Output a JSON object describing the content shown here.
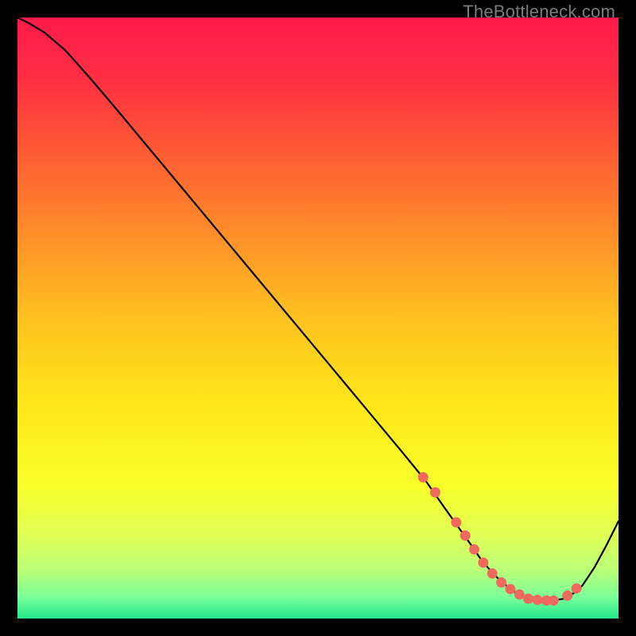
{
  "watermark": "TheBottleneck.com",
  "chart_data": {
    "type": "line",
    "title": "",
    "xlabel": "",
    "ylabel": "",
    "xlim": [
      0,
      100
    ],
    "ylim": [
      0,
      100
    ],
    "grid": false,
    "series": [
      {
        "name": "curve",
        "x": [
          0,
          2,
          4.5,
          8,
          12,
          16,
          20,
          24,
          28,
          32,
          36,
          40,
          44,
          48,
          52,
          56,
          60,
          64,
          68,
          71,
          73.5,
          75.5,
          77,
          79,
          81,
          83,
          85,
          87,
          89,
          91,
          92.5,
          94,
          96,
          98,
          100
        ],
        "values": [
          100,
          99,
          97.5,
          94.5,
          90,
          85.3,
          80.5,
          75.7,
          70.9,
          66.1,
          61.3,
          56.5,
          51.7,
          46.9,
          42.1,
          37.3,
          32.5,
          27.7,
          22.8,
          18.5,
          15,
          12.2,
          10,
          7.6,
          5.7,
          4.2,
          3.3,
          3.0,
          3.0,
          3.3,
          4.2,
          5.5,
          8.5,
          12.2,
          16.2
        ]
      }
    ],
    "markers": {
      "name": "highlight-dots",
      "color": "#ee6a5d",
      "x": [
        67.5,
        69.5,
        73,
        74.5,
        76,
        77.5,
        79,
        80.5,
        82,
        83.5,
        85,
        86.5,
        88,
        89.2,
        91.5,
        93
      ],
      "values": [
        23.5,
        21,
        16,
        13.8,
        11.5,
        9.3,
        7.5,
        6.0,
        4.9,
        4.0,
        3.3,
        3.1,
        3.0,
        3.0,
        3.8,
        5.0
      ]
    },
    "gradient_stops": [
      {
        "offset": 0.0,
        "color": "#ff1a4b"
      },
      {
        "offset": 0.1,
        "color": "#ff2e43"
      },
      {
        "offset": 0.22,
        "color": "#ff5a34"
      },
      {
        "offset": 0.35,
        "color": "#ff8a2a"
      },
      {
        "offset": 0.5,
        "color": "#ffc21f"
      },
      {
        "offset": 0.65,
        "color": "#ffe81a"
      },
      {
        "offset": 0.78,
        "color": "#f8ff2a"
      },
      {
        "offset": 0.86,
        "color": "#e0ff55"
      },
      {
        "offset": 0.92,
        "color": "#baff78"
      },
      {
        "offset": 0.965,
        "color": "#7aff9a"
      },
      {
        "offset": 1.0,
        "color": "#20e88a"
      }
    ]
  }
}
